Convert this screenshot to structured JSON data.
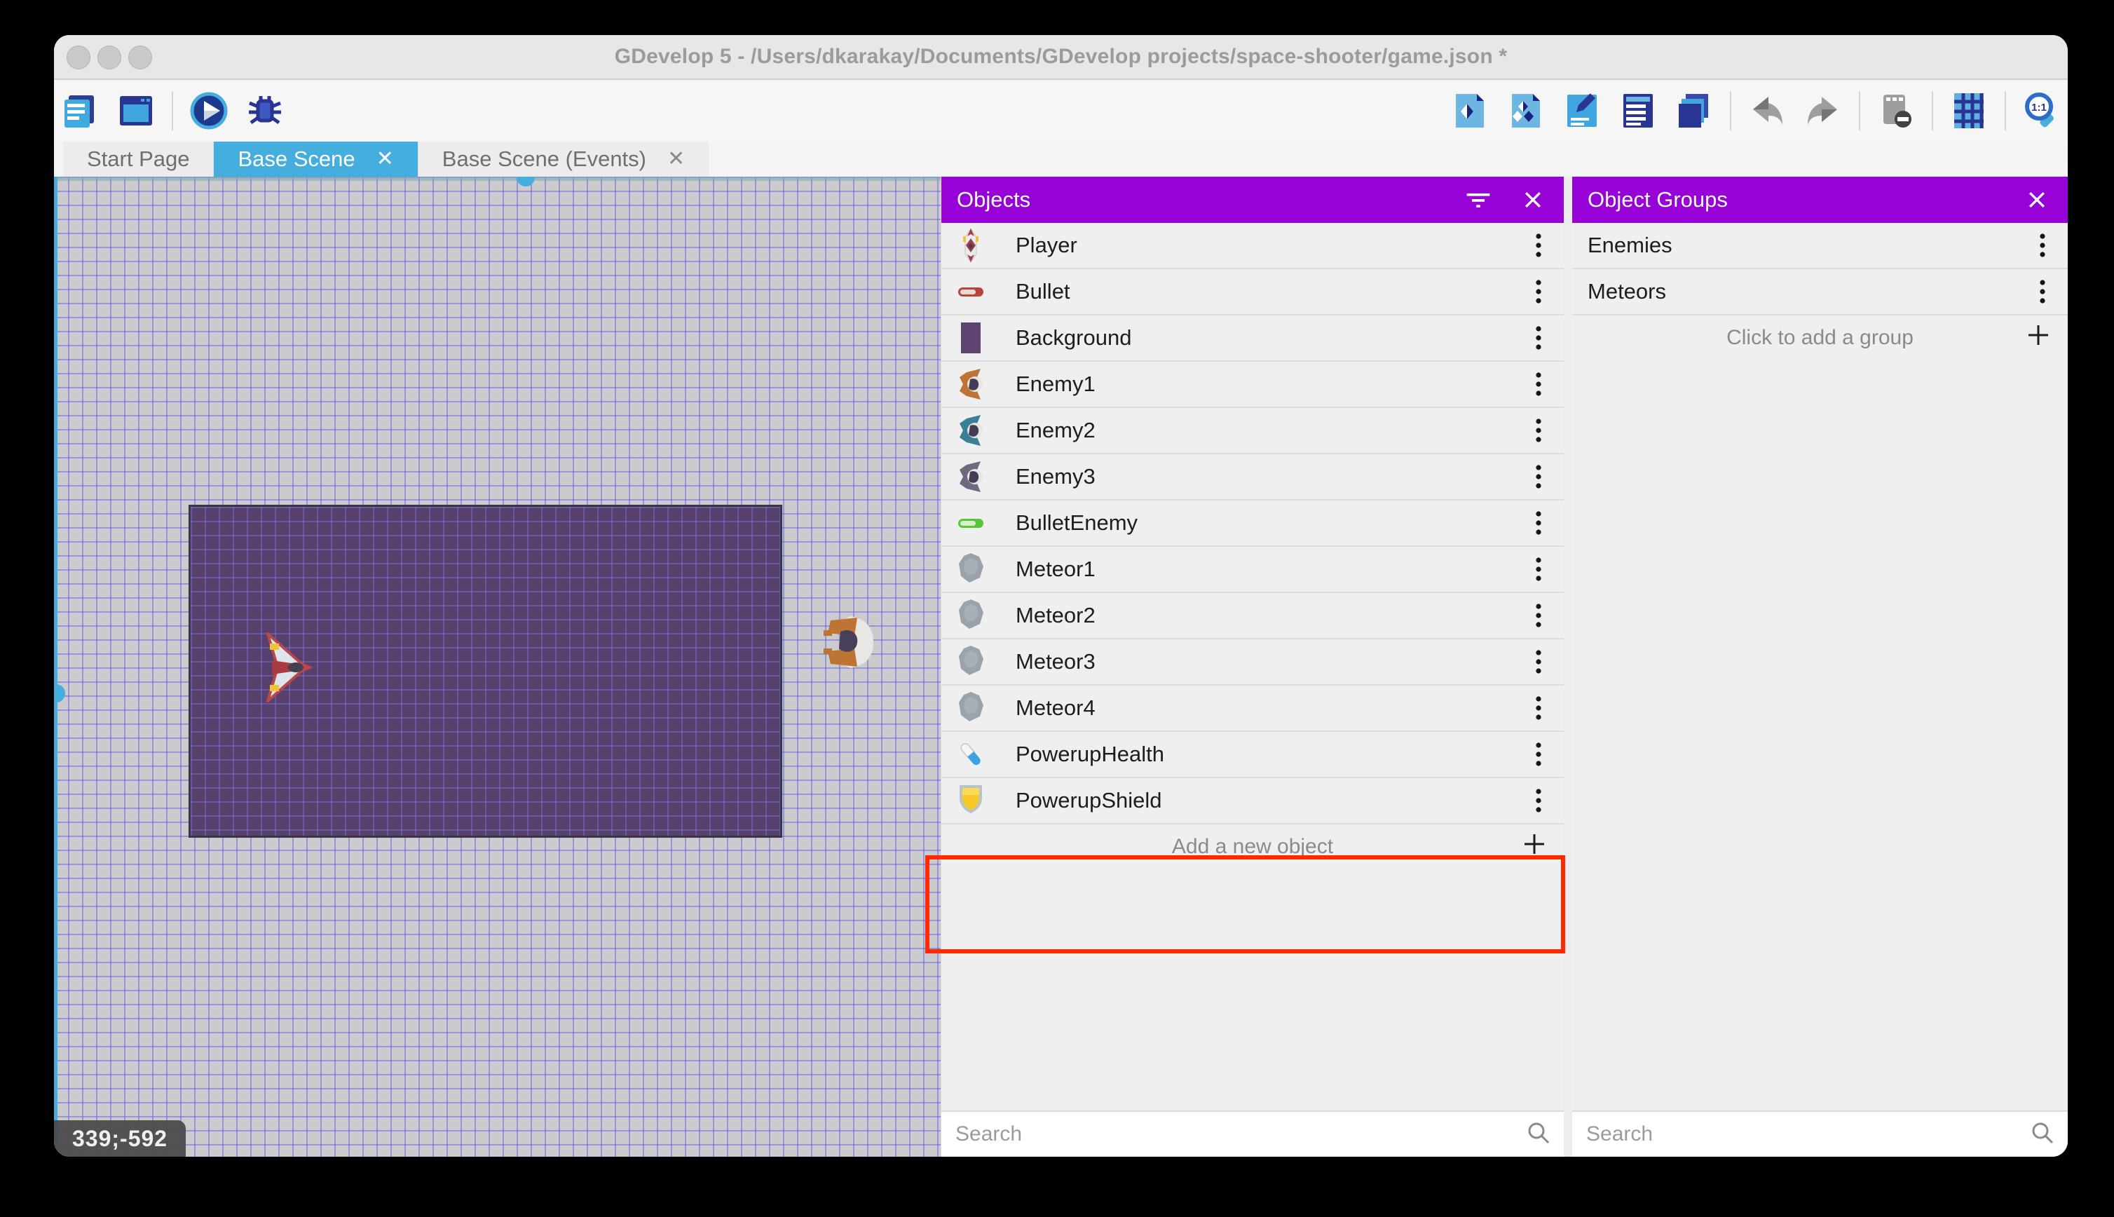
{
  "window": {
    "title": "GDevelop 5 - /Users/dkarakay/Documents/GDevelop projects/space-shooter/game.json *"
  },
  "toolbar": {
    "left_icons": [
      "project-manager-icon",
      "start-page-window-icon",
      "preview-play-icon",
      "debug-bug-icon"
    ],
    "right_icons": [
      "objects-panel-icon",
      "object-groups-panel-icon",
      "properties-panel-icon",
      "instances-list-icon",
      "layers-panel-icon",
      "undo-icon",
      "redo-icon",
      "toggle-mask-icon",
      "grid-icon",
      "zoom-1-1-icon"
    ]
  },
  "tabs": [
    {
      "label": "Start Page",
      "active": false,
      "closable": false
    },
    {
      "label": "Base Scene",
      "active": true,
      "closable": true
    },
    {
      "label": "Base Scene (Events)",
      "active": false,
      "closable": true
    }
  ],
  "canvas": {
    "coordinates": "339;-592",
    "sprites": [
      "player-ship",
      "enemy-ship"
    ]
  },
  "objects_panel": {
    "title": "Objects",
    "items": [
      {
        "name": "Player",
        "icon": "player"
      },
      {
        "name": "Bullet",
        "icon": "bullet"
      },
      {
        "name": "Background",
        "icon": "background"
      },
      {
        "name": "Enemy1",
        "icon": "enemy1"
      },
      {
        "name": "Enemy2",
        "icon": "enemy2"
      },
      {
        "name": "Enemy3",
        "icon": "enemy3"
      },
      {
        "name": "BulletEnemy",
        "icon": "bulletenemy"
      },
      {
        "name": "Meteor1",
        "icon": "meteor"
      },
      {
        "name": "Meteor2",
        "icon": "meteor"
      },
      {
        "name": "Meteor3",
        "icon": "meteor"
      },
      {
        "name": "Meteor4",
        "icon": "meteor"
      },
      {
        "name": "PowerupHealth",
        "icon": "pill"
      },
      {
        "name": "PowerupShield",
        "icon": "shield"
      }
    ],
    "highlighted_items": [
      "PowerupHealth",
      "PowerupShield"
    ],
    "add_label": "Add a new object",
    "search_placeholder": "Search"
  },
  "groups_panel": {
    "title": "Object Groups",
    "items": [
      {
        "name": "Enemies"
      },
      {
        "name": "Meteors"
      }
    ],
    "add_label": "Click to add a group",
    "search_placeholder": "Search"
  },
  "colors": {
    "accent_blue": "#45aede",
    "panel_purple": "#9702d7",
    "highlight_red": "#ff2a00",
    "scene_rect_purple": "#57406c"
  }
}
